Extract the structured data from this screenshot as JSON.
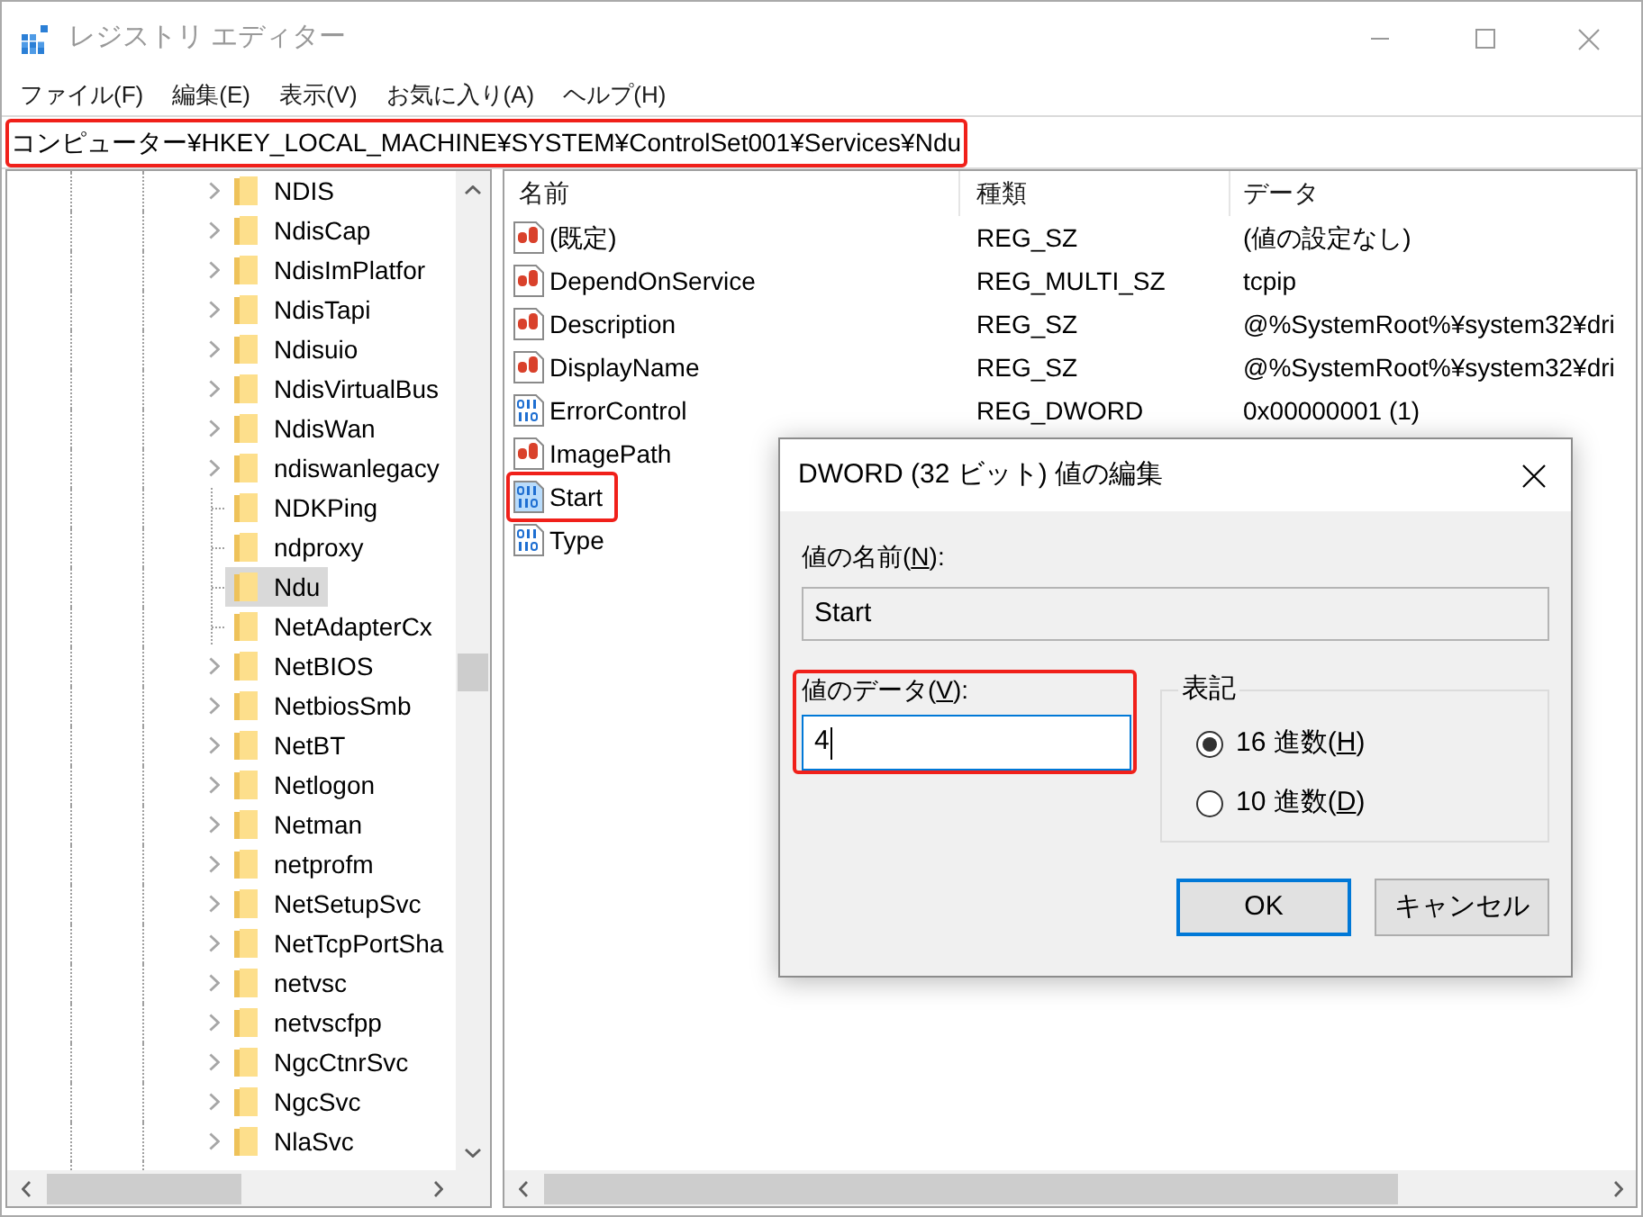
{
  "window": {
    "title": "レジストリ エディター",
    "active": false
  },
  "menu": [
    "ファイル(F)",
    "編集(E)",
    "表示(V)",
    "お気に入り(A)",
    "ヘルプ(H)"
  ],
  "address_bar": {
    "path": "コンピューター¥HKEY_LOCAL_MACHINE¥SYSTEM¥ControlSet001¥Services¥Ndu",
    "highlighted": true
  },
  "tree": {
    "items": [
      {
        "label": "NDIS",
        "has_children": true,
        "selected": false
      },
      {
        "label": "NdisCap",
        "has_children": true,
        "selected": false
      },
      {
        "label": "NdisImPlatfor",
        "has_children": true,
        "selected": false
      },
      {
        "label": "NdisTapi",
        "has_children": true,
        "selected": false
      },
      {
        "label": "Ndisuio",
        "has_children": true,
        "selected": false
      },
      {
        "label": "NdisVirtualBus",
        "has_children": true,
        "selected": false
      },
      {
        "label": "NdisWan",
        "has_children": true,
        "selected": false
      },
      {
        "label": "ndiswanlegacy",
        "has_children": true,
        "selected": false
      },
      {
        "label": "NDKPing",
        "has_children": false,
        "selected": false
      },
      {
        "label": "ndproxy",
        "has_children": false,
        "selected": false
      },
      {
        "label": "Ndu",
        "has_children": false,
        "selected": true
      },
      {
        "label": "NetAdapterCx",
        "has_children": false,
        "selected": false
      },
      {
        "label": "NetBIOS",
        "has_children": true,
        "selected": false
      },
      {
        "label": "NetbiosSmb",
        "has_children": true,
        "selected": false
      },
      {
        "label": "NetBT",
        "has_children": true,
        "selected": false
      },
      {
        "label": "Netlogon",
        "has_children": true,
        "selected": false
      },
      {
        "label": "Netman",
        "has_children": true,
        "selected": false
      },
      {
        "label": "netprofm",
        "has_children": true,
        "selected": false
      },
      {
        "label": "NetSetupSvc",
        "has_children": true,
        "selected": false
      },
      {
        "label": "NetTcpPortSha",
        "has_children": true,
        "selected": false
      },
      {
        "label": "netvsc",
        "has_children": true,
        "selected": false
      },
      {
        "label": "netvscfpp",
        "has_children": true,
        "selected": false
      },
      {
        "label": "NgcCtnrSvc",
        "has_children": true,
        "selected": false
      },
      {
        "label": "NgcSvc",
        "has_children": true,
        "selected": false
      },
      {
        "label": "NlaSvc",
        "has_children": true,
        "selected": false
      }
    ]
  },
  "values": {
    "columns": [
      "名前",
      "種類",
      "データ"
    ],
    "rows": [
      {
        "kind": "string",
        "name": "(既定)",
        "type": "REG_SZ",
        "data": "(値の設定なし)",
        "selected": false,
        "highlighted": false
      },
      {
        "kind": "string",
        "name": "DependOnService",
        "type": "REG_MULTI_SZ",
        "data": "tcpip",
        "selected": false,
        "highlighted": false
      },
      {
        "kind": "string",
        "name": "Description",
        "type": "REG_SZ",
        "data": "@%SystemRoot%¥system32¥dri",
        "selected": false,
        "highlighted": false
      },
      {
        "kind": "string",
        "name": "DisplayName",
        "type": "REG_SZ",
        "data": "@%SystemRoot%¥system32¥dri",
        "selected": false,
        "highlighted": false
      },
      {
        "kind": "binary",
        "name": "ErrorControl",
        "type": "REG_DWORD",
        "data": "0x00000001 (1)",
        "selected": false,
        "highlighted": false
      },
      {
        "kind": "string",
        "name": "ImagePath",
        "selected": false,
        "highlighted": false
      },
      {
        "kind": "binary",
        "name": "Start",
        "selected": true,
        "highlighted": true
      },
      {
        "kind": "binary",
        "name": "Type",
        "selected": false,
        "highlighted": false
      }
    ]
  },
  "dialog": {
    "title": "DWORD (32 ビット) 値の編集",
    "name_field": {
      "label_before": "値の名前(",
      "access_key": "N",
      "label_after": "):",
      "value": "Start",
      "read_only": true
    },
    "data_field": {
      "label_before": "値のデータ(",
      "access_key": "V",
      "label_after": "):",
      "value": "4",
      "focused": true,
      "highlighted": true
    },
    "base": {
      "title": "表記",
      "options": [
        {
          "label_before": "16 進数(",
          "access_key": "H",
          "label_after": ")",
          "selected": true
        },
        {
          "label_before": "10 進数(",
          "access_key": "D",
          "label_after": ")",
          "selected": false
        }
      ]
    },
    "buttons": [
      {
        "label": "OK",
        "default": true
      },
      {
        "label": "キャンセル",
        "default": false
      }
    ]
  }
}
